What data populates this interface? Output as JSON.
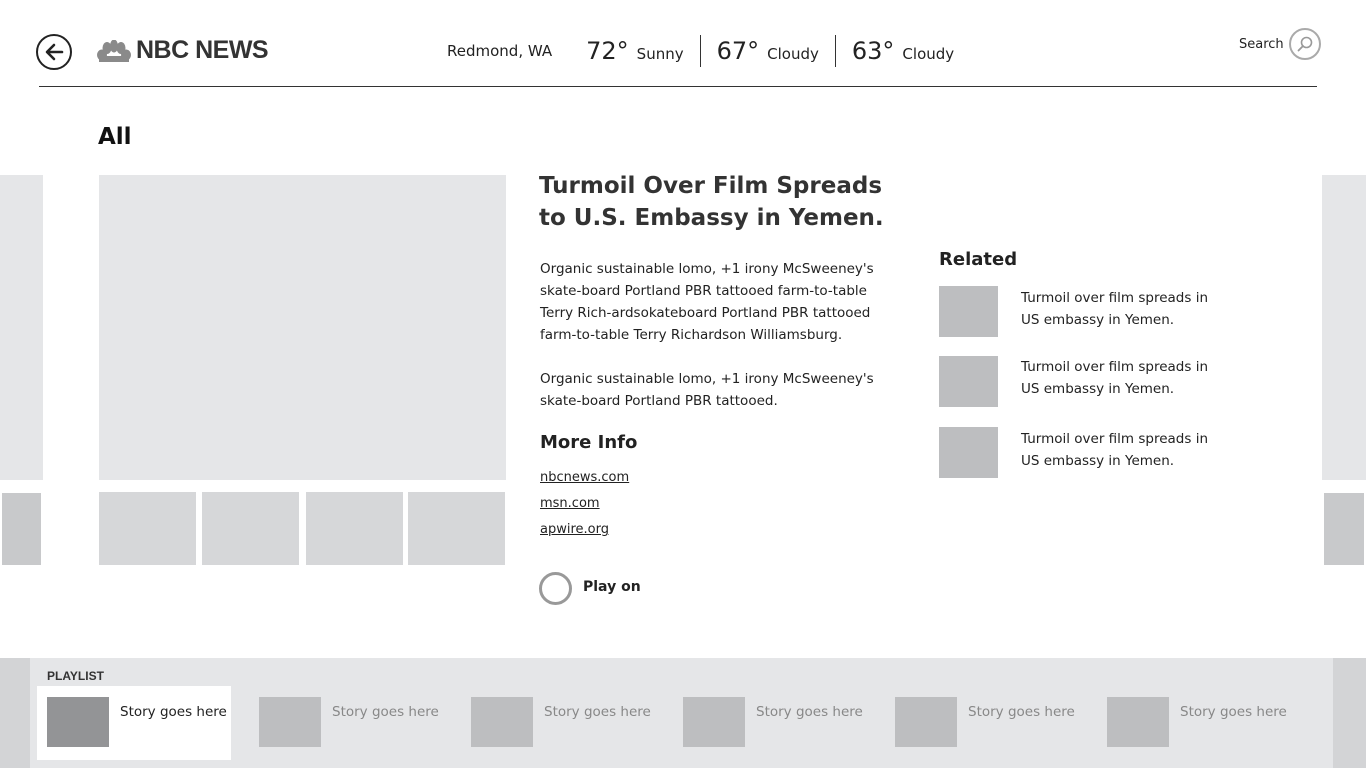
{
  "header": {
    "brand": "NBC NEWS",
    "weather": {
      "location": "Redmond, WA",
      "forecast": [
        {
          "temp": "72°",
          "condition": "Sunny"
        },
        {
          "temp": "67°",
          "condition": "Cloudy"
        },
        {
          "temp": "63°",
          "condition": "Cloudy"
        }
      ]
    },
    "search_label": "Search"
  },
  "section": {
    "title": "All"
  },
  "article": {
    "headline": "Turmoil Over Film Spreads to U.S. Embassy in Yemen.",
    "paragraphs": [
      "Organic sustainable lomo, +1 irony McSweeney's skate-board Portland PBR tattooed farm-to-table Terry Rich-ardsokateboard Portland PBR tattooed farm-to-table Terry Richardson Williamsburg.",
      "Organic sustainable lomo, +1 irony McSweeney's skate-board Portland PBR tattooed."
    ],
    "more_info_title": "More Info",
    "links": [
      "nbcnews.com",
      "msn.com",
      "apwire.org"
    ],
    "play_label": "Play on"
  },
  "related": {
    "title": "Related",
    "items": [
      {
        "text": "Turmoil over film spreads in US embassy in Yemen."
      },
      {
        "text": "Turmoil over film spreads in US embassy in Yemen."
      },
      {
        "text": "Turmoil over film spreads in US embassy in Yemen."
      }
    ]
  },
  "playlist": {
    "label": "PLAYLIST",
    "items": [
      {
        "text": "Story goes here",
        "active": true
      },
      {
        "text": "Story goes here",
        "active": false
      },
      {
        "text": "Story goes here",
        "active": false
      },
      {
        "text": "Story goes here",
        "active": false
      },
      {
        "text": "Story goes here",
        "active": false
      },
      {
        "text": "Story goes here",
        "active": false
      }
    ]
  },
  "icons": {
    "back": "back-arrow-icon",
    "logo": "peacock-icon",
    "search": "search-icon",
    "play": "circle-icon"
  }
}
